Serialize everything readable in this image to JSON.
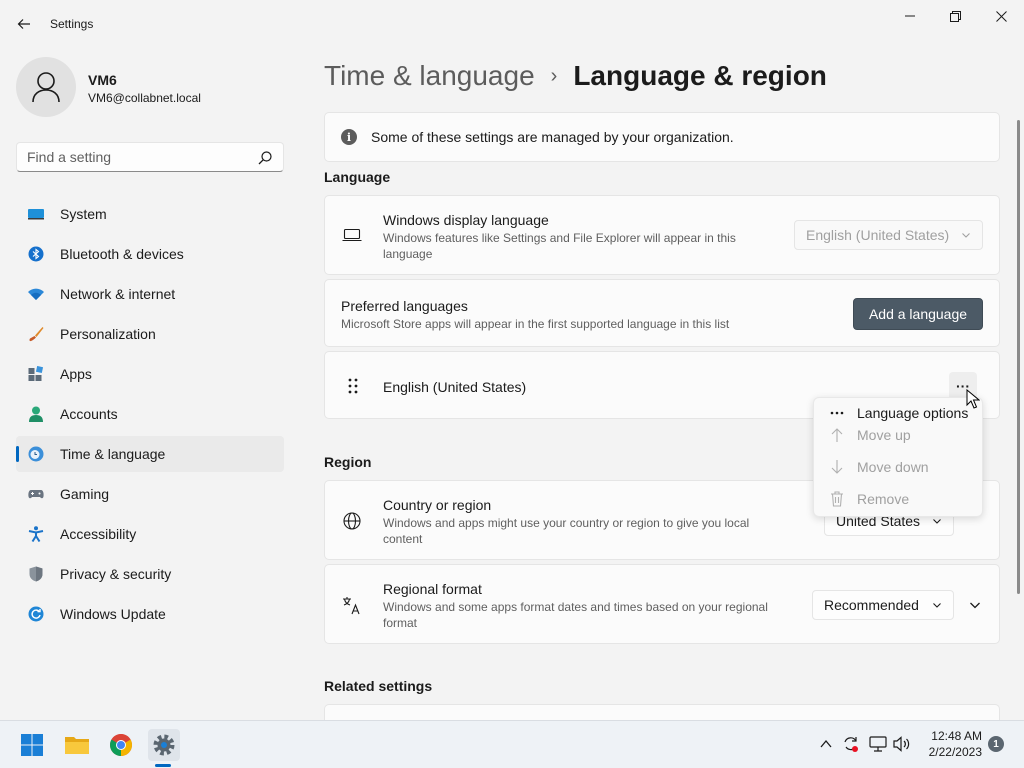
{
  "window": {
    "title": "Settings",
    "controls": {
      "minimize": "minimize-icon",
      "maximize": "restore-icon",
      "close": "close-icon"
    }
  },
  "profile": {
    "name": "VM6",
    "email": "VM6@collabnet.local"
  },
  "search": {
    "placeholder": "Find a setting"
  },
  "sidebar": {
    "items": [
      {
        "label": "System",
        "icon": "system-icon"
      },
      {
        "label": "Bluetooth & devices",
        "icon": "bluetooth-icon"
      },
      {
        "label": "Network & internet",
        "icon": "wifi-icon"
      },
      {
        "label": "Personalization",
        "icon": "brush-icon"
      },
      {
        "label": "Apps",
        "icon": "apps-icon"
      },
      {
        "label": "Accounts",
        "icon": "accounts-icon"
      },
      {
        "label": "Time & language",
        "icon": "clock-globe-icon",
        "active": true
      },
      {
        "label": "Gaming",
        "icon": "gamepad-icon"
      },
      {
        "label": "Accessibility",
        "icon": "accessibility-icon"
      },
      {
        "label": "Privacy & security",
        "icon": "shield-icon"
      },
      {
        "label": "Windows Update",
        "icon": "update-icon"
      }
    ]
  },
  "main": {
    "breadcrumb": {
      "parent": "Time & language",
      "separator": "›",
      "current": "Language & region"
    },
    "banner": "Some of these settings are managed by your organization.",
    "language": {
      "heading": "Language",
      "display_language": {
        "title": "Windows display language",
        "description": "Windows features like Settings and File Explorer will appear in this language",
        "value": "English (United States)"
      },
      "preferred": {
        "title": "Preferred languages",
        "description": "Microsoft Store apps will appear in the first supported language in this list",
        "button": "Add a language"
      },
      "entry": {
        "label": "English (United States)",
        "more": "···"
      }
    },
    "context_menu": {
      "items": [
        {
          "label": "Language options",
          "icon": "more-icon",
          "enabled": true
        },
        {
          "label": "Move up",
          "icon": "arrow-up-icon",
          "enabled": false
        },
        {
          "label": "Move down",
          "icon": "arrow-down-icon",
          "enabled": false
        },
        {
          "label": "Remove",
          "icon": "trash-icon",
          "enabled": false
        }
      ]
    },
    "region": {
      "heading": "Region",
      "country": {
        "title": "Country or region",
        "description": "Windows and apps might use your country or region to give you local content",
        "value": "United States"
      },
      "format": {
        "title": "Regional format",
        "description": "Windows and some apps format dates and times based on your regional format",
        "value": "Recommended"
      }
    },
    "related": {
      "heading": "Related settings"
    }
  },
  "taskbar": {
    "apps": [
      "start-icon",
      "file-explorer-icon",
      "chrome-icon",
      "settings-icon"
    ],
    "time": "12:48 AM",
    "date": "2/22/2023",
    "notifications": "1"
  },
  "colors": {
    "accent": "#0067c0",
    "button": "#4c5a66",
    "background": "#f3f3f3"
  }
}
